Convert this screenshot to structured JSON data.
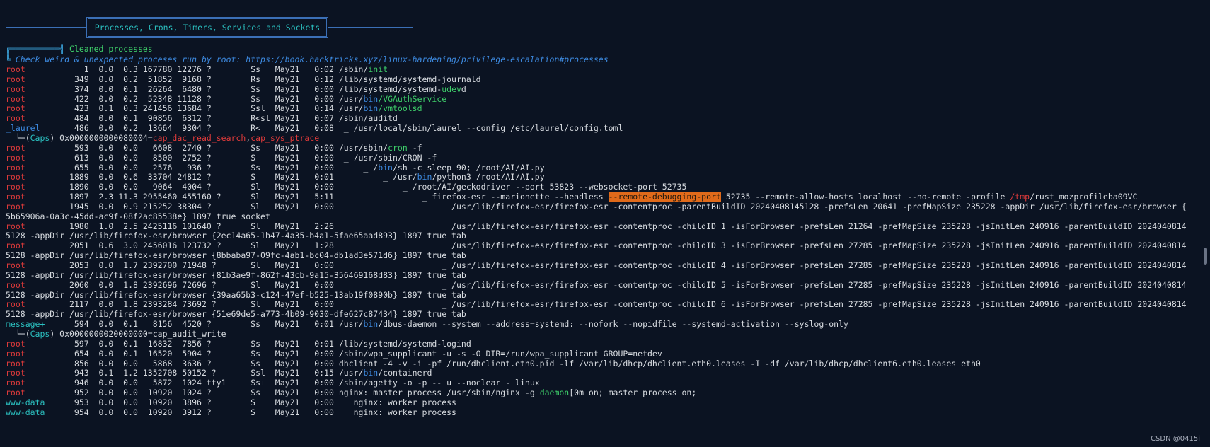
{
  "banner": {
    "title": "Processes, Crons, Timers, Services and Sockets"
  },
  "section": {
    "title": "Cleaned processes",
    "prefix": "╔══════════╣ ",
    "hint_prefix": "╚ ",
    "hint": "Check weird & unexpected proceses run by root: https://book.hacktricks.xyz/linux-hardening/privilege-escalation#processes"
  },
  "lines": [
    [
      [
        "root",
        "red"
      ],
      [
        "            1  0.0  0.3 167780 12276 ?        Ss   May21   0:02 /sbin/",
        "rest"
      ],
      [
        "init",
        "green"
      ]
    ],
    [
      [
        "root",
        "red"
      ],
      [
        "          349  0.0  0.2  51852  9168 ?        Rs   May21   0:12 /lib/systemd/systemd-journald",
        "rest"
      ]
    ],
    [
      [
        "root",
        "red"
      ],
      [
        "          374  0.0  0.1  26264  6480 ?        Ss   May21   0:00 /lib/systemd/systemd-",
        "rest"
      ],
      [
        "udev",
        "green"
      ],
      [
        "d",
        "rest"
      ]
    ],
    [
      [
        "root",
        "red"
      ],
      [
        "          422  0.0  0.2  52348 11128 ?        Ss   May21   0:00 /usr/",
        "rest"
      ],
      [
        "bin",
        "blue"
      ],
      [
        "/VGAuthService",
        "green"
      ]
    ],
    [
      [
        "root",
        "red"
      ],
      [
        "          423  0.1  0.3 241456 13684 ?        Ssl  May21   0:14 /usr/",
        "rest"
      ],
      [
        "bin",
        "blue"
      ],
      [
        "/vmtoolsd",
        "green"
      ]
    ],
    [
      [
        "root",
        "red"
      ],
      [
        "          484  0.0  0.1  90856  6312 ?        R<sl May21   0:07 /sbin/auditd",
        "rest"
      ]
    ],
    [
      [
        "_laurel",
        "blue"
      ],
      [
        "       486  0.0  0.2  13664  9304 ?        R<   May21   0:08  _ /usr/local/sbin/laurel --config /etc/laurel/config.toml",
        "rest"
      ]
    ],
    [
      [
        "  └─(",
        "rest"
      ],
      [
        "Caps",
        "cyan"
      ],
      [
        ") 0x0000000000080004=",
        "rest"
      ],
      [
        "cap_dac_read_search",
        "red"
      ],
      [
        ",",
        "rest"
      ],
      [
        "cap_sys_ptrace",
        "red"
      ]
    ],
    [
      [
        "root",
        "red"
      ],
      [
        "          593  0.0  0.0   6608  2740 ?        Ss   May21   0:00 /usr/sbin/",
        "rest"
      ],
      [
        "cron",
        "green"
      ],
      [
        " -f",
        "rest"
      ]
    ],
    [
      [
        "root",
        "red"
      ],
      [
        "          613  0.0  0.0   8500  2752 ?        S    May21   0:00  _ /usr/sbin/CRON -f",
        "rest"
      ]
    ],
    [
      [
        "root",
        "red"
      ],
      [
        "          655  0.0  0.0   2576   936 ?        Ss   May21   0:00      _ /",
        "rest"
      ],
      [
        "bin",
        "blue"
      ],
      [
        "/sh -c sleep 90; /root/AI/AI.py",
        "rest"
      ]
    ],
    [
      [
        "root",
        "red"
      ],
      [
        "         1889  0.0  0.6  33704 24812 ?        S    May21   0:01          _ /usr/",
        "rest"
      ],
      [
        "bin",
        "blue"
      ],
      [
        "/python3 /root/AI/AI.py",
        "rest"
      ]
    ],
    [
      [
        "root",
        "red"
      ],
      [
        "         1890  0.0  0.0   9064  4004 ?        Sl   May21   0:00              _ /root/AI/geckodriver --port 53823 --websocket-port 52735",
        "rest"
      ]
    ],
    [
      [
        "root",
        "red"
      ],
      [
        "         1897  2.3 11.3 2955460 455160 ?      Sl   May21   5:11                  _ firefox-esr --marionette --headless ",
        "rest"
      ],
      [
        "--remote-debugging-port",
        "hl"
      ],
      [
        " 52735 --remote-allow-hosts localhost --no-remote -profile ",
        "rest"
      ],
      [
        "/tmp",
        "red"
      ],
      [
        "/rust_mozprofileba09VC",
        "rest"
      ]
    ],
    [
      [
        "root",
        "red"
      ],
      [
        "         1945  0.0  0.9 215252 38304 ?        Sl   May21   0:00                      _ /usr/lib/firefox-esr/firefox-esr -contentproc -parentBuildID 20240408145128 -prefsLen 20641 -prefMapSize 235228 -appDir /usr/lib/firefox-esr/browser {",
        "rest"
      ]
    ],
    [
      [
        "5b65906a-0a3c-45dd-ac9f-08f2ac85538e} 1897 true socket",
        "rest"
      ]
    ],
    [
      [
        "root",
        "red"
      ],
      [
        "         1980  1.0  2.5 2425116 101640 ?      Sl   May21   2:26                      _ /usr/lib/firefox-esr/firefox-esr -contentproc -childID 1 -isForBrowser -prefsLen 21264 -prefMapSize 235228 -jsInitLen 240916 -parentBuildID 2024040814",
        "rest"
      ]
    ],
    [
      [
        "5128 -appDir /usr/lib/firefox-esr/browser {2ec14a65-1b47-4a35-b4a1-5fae65aad893} 1897 true tab",
        "rest"
      ]
    ],
    [
      [
        "root",
        "red"
      ],
      [
        "         2051  0.6  3.0 2456016 123732 ?      Sl   May21   1:28                      _ /usr/lib/firefox-esr/firefox-esr -contentproc -childID 3 -isForBrowser -prefsLen 27285 -prefMapSize 235228 -jsInitLen 240916 -parentBuildID 2024040814",
        "rest"
      ]
    ],
    [
      [
        "5128 -appDir /usr/lib/firefox-esr/browser {8bbaba97-09fc-4ab1-bc04-db1ad3e571d6} 1897 true tab",
        "rest"
      ]
    ],
    [
      [
        "root",
        "red"
      ],
      [
        "         2053  0.0  1.7 2392700 71948 ?       Sl   May21   0:00                      _ /usr/lib/firefox-esr/firefox-esr -contentproc -childID 4 -isForBrowser -prefsLen 27285 -prefMapSize 235228 -jsInitLen 240916 -parentBuildID 2024040814",
        "rest"
      ]
    ],
    [
      [
        "5128 -appDir /usr/lib/firefox-esr/browser {81b3ae9f-862f-43cb-9a15-356469168d83} 1897 true tab",
        "rest"
      ]
    ],
    [
      [
        "root",
        "red"
      ],
      [
        "         2060  0.0  1.8 2392696 72696 ?       Sl   May21   0:00                      _ /usr/lib/firefox-esr/firefox-esr -contentproc -childID 5 -isForBrowser -prefsLen 27285 -prefMapSize 235228 -jsInitLen 240916 -parentBuildID 2024040814",
        "rest"
      ]
    ],
    [
      [
        "5128 -appDir /usr/lib/firefox-esr/browser {39aa65b3-c124-47ef-b525-13ab19f0890b} 1897 true tab",
        "rest"
      ]
    ],
    [
      [
        "root",
        "red"
      ],
      [
        "         2117  0.0  1.8 2393284 73692 ?       Sl   May21   0:00                      _ /usr/lib/firefox-esr/firefox-esr -contentproc -childID 6 -isForBrowser -prefsLen 27285 -prefMapSize 235228 -jsInitLen 240916 -parentBuildID 2024040814",
        "rest"
      ]
    ],
    [
      [
        "5128 -appDir /usr/lib/firefox-esr/browser {51e69de5-a773-4b09-9030-dfe627c87434} 1897 true tab",
        "rest"
      ]
    ],
    [
      [
        "message+",
        "cyan"
      ],
      [
        "      594  0.0  0.1   8156  4520 ?        Ss   May21   0:01 /usr/",
        "rest"
      ],
      [
        "bin",
        "blue"
      ],
      [
        "/dbus-daemon --system --address=systemd: --nofork --nopidfile --systemd-activation --syslog-only",
        "rest"
      ]
    ],
    [
      [
        "  └─(",
        "rest"
      ],
      [
        "Caps",
        "cyan"
      ],
      [
        ") 0x0000000020000000=cap_audit_write",
        "rest"
      ]
    ],
    [
      [
        "root",
        "red"
      ],
      [
        "          597  0.0  0.1  16832  7856 ?        Ss   May21   0:01 /lib/systemd/systemd-logind",
        "rest"
      ]
    ],
    [
      [
        "root",
        "red"
      ],
      [
        "          654  0.0  0.1  16520  5904 ?        Ss   May21   0:00 /sbin/wpa_supplicant -u -s -O DIR=/run/wpa_supplicant GROUP=netdev",
        "rest"
      ]
    ],
    [
      [
        "root",
        "red"
      ],
      [
        "          856  0.0  0.0   5868  3636 ?        Ss   May21   0:00 dhclient -4 -v -i -pf /run/dhclient.eth0.pid -lf /var/lib/dhcp/dhclient.eth0.leases -I -df /var/lib/dhcp/dhclient6.eth0.leases eth0",
        "rest"
      ]
    ],
    [
      [
        "root",
        "red"
      ],
      [
        "          943  0.1  1.2 1352708 50152 ?       Ssl  May21   0:15 /usr/",
        "rest"
      ],
      [
        "bin",
        "blue"
      ],
      [
        "/containerd",
        "rest"
      ]
    ],
    [
      [
        "root",
        "red"
      ],
      [
        "          946  0.0  0.0   5872  1024 tty1     Ss+  May21   0:00 /sbin/agetty -o -p -- u --noclear - linux",
        "rest"
      ]
    ],
    [
      [
        "root",
        "red"
      ],
      [
        "          952  0.0  0.0  10920  1024 ?        Ss   May21   0:00 nginx: master process /usr/sbin/nginx -g ",
        "rest"
      ],
      [
        "daemon",
        "green"
      ],
      [
        "[0m on; master_process on;",
        "rest"
      ]
    ],
    [
      [
        "www-data",
        "cyan"
      ],
      [
        "      953  0.0  0.0  10920  3896 ?        S    May21   0:00  _ nginx: worker process",
        "rest"
      ]
    ],
    [
      [
        "www-data",
        "cyan"
      ],
      [
        "      954  0.0  0.0  10920  3912 ?        S    May21   0:00  _ nginx: worker process",
        "rest"
      ]
    ]
  ],
  "watermark": "CSDN @0415i"
}
